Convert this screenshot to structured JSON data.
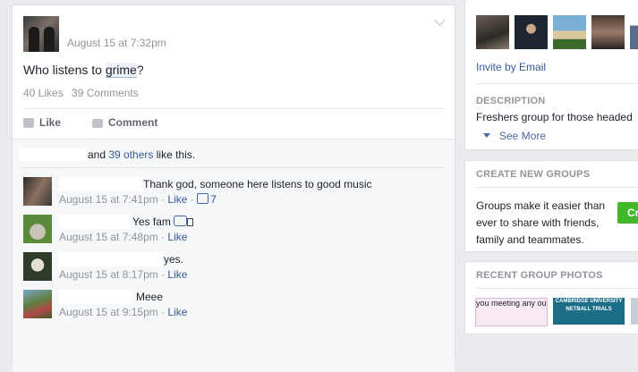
{
  "post": {
    "time": "August 15 at 7:32pm",
    "text_before": "Who listens to ",
    "text_highlight": "grime",
    "text_after": "?",
    "likes": "40 Likes",
    "comments_count": "39 Comments",
    "like_label": "Like",
    "comment_label": "Comment"
  },
  "likes_line": {
    "and": "and ",
    "others": "39 others",
    "suffix": " like this."
  },
  "comments": [
    {
      "text": "Thank god, someone here listens to good music",
      "time": "August 15 at 7:41pm",
      "like": "Like",
      "likes": "7"
    },
    {
      "text": "Yes fam",
      "time": "August 15 at 7:48pm",
      "like": "Like"
    },
    {
      "text": "yes.",
      "time": "August 15 at 8:17pm",
      "like": "Like"
    },
    {
      "text": "Meee",
      "time": "August 15 at 9:15pm",
      "like": "Like"
    }
  ],
  "sidebar": {
    "invite": "Invite by Email",
    "description_heading": "DESCRIPTION",
    "description_text": "Freshers group for those headed",
    "see_more": "See More",
    "create_heading": "CREATE NEW GROUPS",
    "create_line1": "Groups make it easier than",
    "create_line2": "ever to share with friends,",
    "create_line3": "family and teammates.",
    "create_button": "Cr",
    "recent_heading": "RECENT GROUP PHOTOS",
    "photo1_text": "you meeting any ou",
    "photo2_text": "CAMBRIDGE UNIVERSITY NETBALL TRIALS"
  },
  "colors": {
    "link": "#365899",
    "meta": "#90949c",
    "green": "#42b72a"
  }
}
